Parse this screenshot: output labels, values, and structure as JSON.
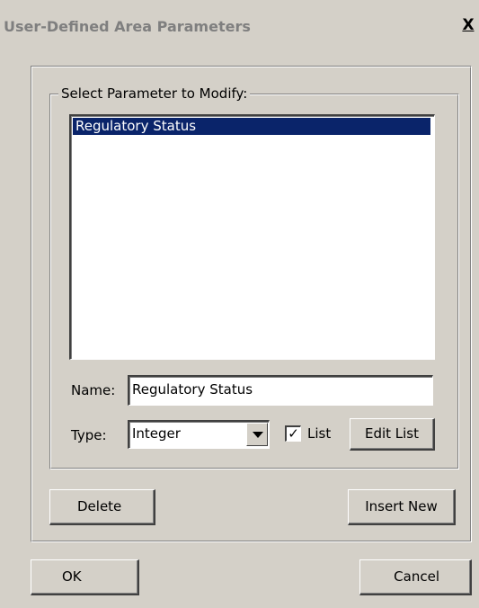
{
  "window": {
    "title": "User-Defined Area Parameters",
    "close_label": "X"
  },
  "group": {
    "label": "Select Parameter to Modify:"
  },
  "parameter_list": {
    "items": [
      {
        "label": "Regulatory Status",
        "selected": true
      }
    ]
  },
  "form": {
    "name_label": "Name:",
    "name_value": "Regulatory Status",
    "type_label": "Type:",
    "type_value": "Integer",
    "list_label": "List",
    "list_checked": true,
    "edit_list_label": "Edit List"
  },
  "actions": {
    "delete_label": "Delete",
    "insert_new_label": "Insert New"
  },
  "dialog_buttons": {
    "ok_label": "OK",
    "cancel_label": "Cancel"
  },
  "colors": {
    "dialog_bg": "#d4d0c8",
    "selection_bg": "#0a246a",
    "selection_fg": "#ffffff",
    "title_text": "#7f7f7f"
  }
}
